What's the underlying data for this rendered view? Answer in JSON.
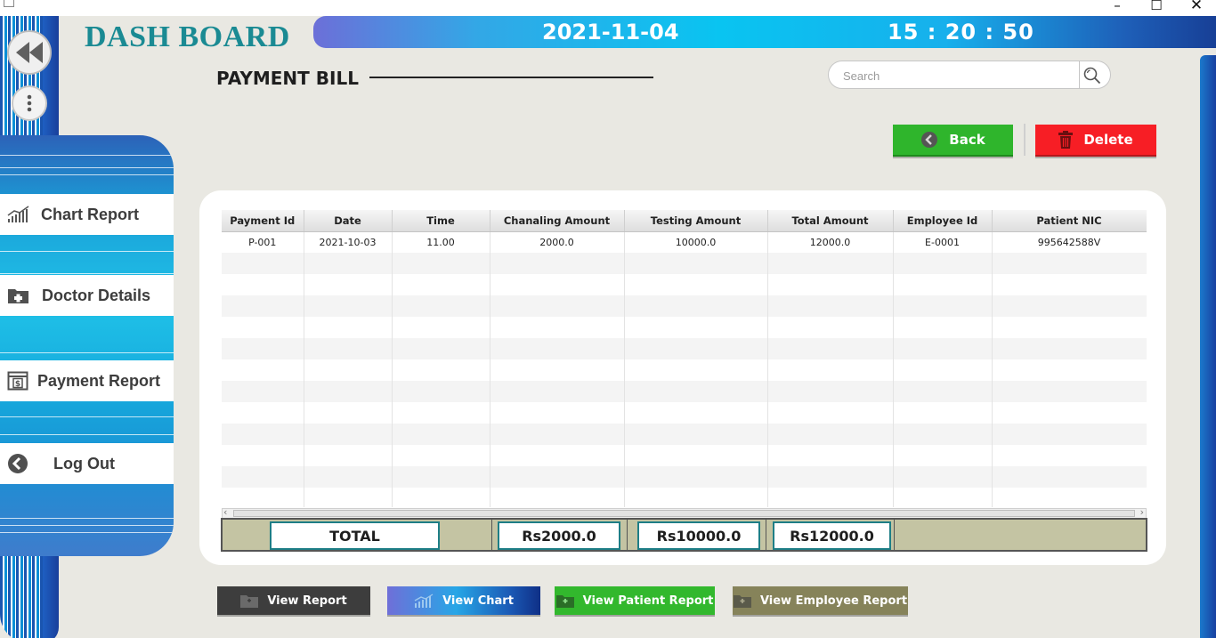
{
  "window": {
    "controls": {
      "minimize": "–",
      "maximize": "☐",
      "close": "✕"
    }
  },
  "header": {
    "title": "DASH BOARD",
    "date": "2021-11-04",
    "time": "15 : 20 : 50"
  },
  "sidebar": {
    "items": [
      {
        "label": "Chart Report",
        "icon": "chart-icon"
      },
      {
        "label": "Doctor Details",
        "icon": "medical-folder-icon"
      },
      {
        "label": "Payment Report",
        "icon": "payment-icon"
      },
      {
        "label": "Log Out",
        "icon": "back-circle-icon"
      }
    ]
  },
  "page": {
    "title": "PAYMENT BILL",
    "search_placeholder": "Search",
    "back_label": "Back",
    "delete_label": "Delete"
  },
  "table": {
    "columns": [
      "Payment Id",
      "Date",
      "Time",
      "Chanaling Amount",
      "Testing Amount",
      "Total Amount",
      "Employee Id",
      "Patient NIC"
    ],
    "rows": [
      [
        "P-001",
        "2021-10-03",
        "11.00",
        "2000.0",
        "10000.0",
        "12000.0",
        "E-0001",
        "995642588V"
      ]
    ]
  },
  "totals": {
    "label": "TOTAL",
    "chanaling": "Rs2000.0",
    "testing": "Rs10000.0",
    "total": "Rs12000.0"
  },
  "footer_buttons": {
    "view_report": "View Report",
    "view_chart": "View Chart",
    "view_patient_report": "View Patient Report",
    "view_employee_report": "View Employee Report"
  },
  "colors": {
    "accent_teal": "#1a8a93",
    "back_green": "#2fb52c",
    "delete_red": "#f71e25",
    "totals_bg": "#c4c4a3"
  }
}
